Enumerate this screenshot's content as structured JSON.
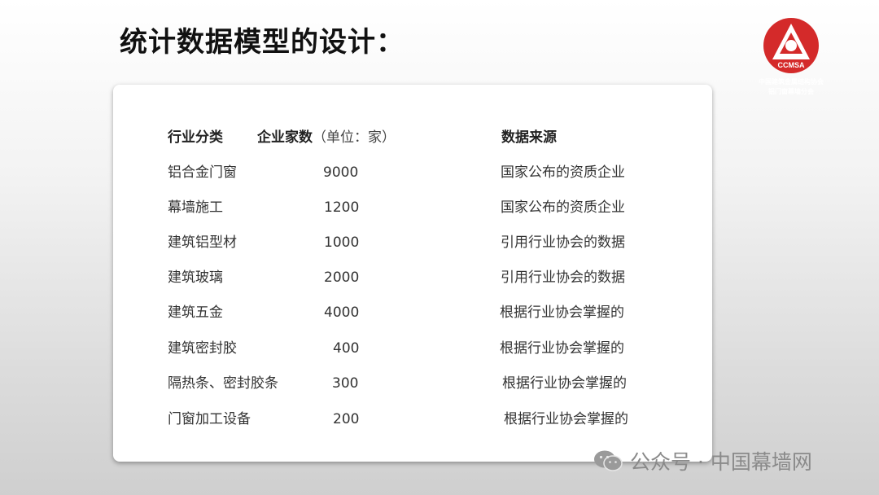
{
  "slide": {
    "title": "统计数据模型的设计："
  },
  "logo": {
    "text": "CCMSA",
    "line1": "中国建筑金属结构协会",
    "line2": "铝门窗幕墙分会",
    "colors": {
      "primary": "#d42a2a",
      "white": "#ffffff"
    }
  },
  "table": {
    "headers": {
      "category": "行业分类",
      "count": "企业家数",
      "unit": "（单位：家）",
      "source": "数据来源"
    },
    "rows": [
      {
        "category": "铝合金门窗",
        "count": "9000",
        "source": "国家公布的资质企业"
      },
      {
        "category": "幕墙施工",
        "count": "1200",
        "source": "国家公布的资质企业"
      },
      {
        "category": "建筑铝型材",
        "count": "1000",
        "source": "引用行业协会的数据"
      },
      {
        "category": "建筑玻璃",
        "count": "2000",
        "source": "引用行业协会的数据"
      },
      {
        "category": "建筑五金",
        "count": "4000",
        "source": "根据行业协会掌握的"
      },
      {
        "category": "建筑密封胶",
        "count": "400",
        "source": "根据行业协会掌握的"
      },
      {
        "category": "隔热条、密封胶条",
        "count": "300",
        "source": "根据行业协会掌握的"
      },
      {
        "category": "门窗加工设备",
        "count": "200",
        "source": "根据行业协会掌握的"
      }
    ]
  },
  "watermark": {
    "text": "公众号 · 中国幕墙网",
    "icon": "wechat-icon"
  }
}
